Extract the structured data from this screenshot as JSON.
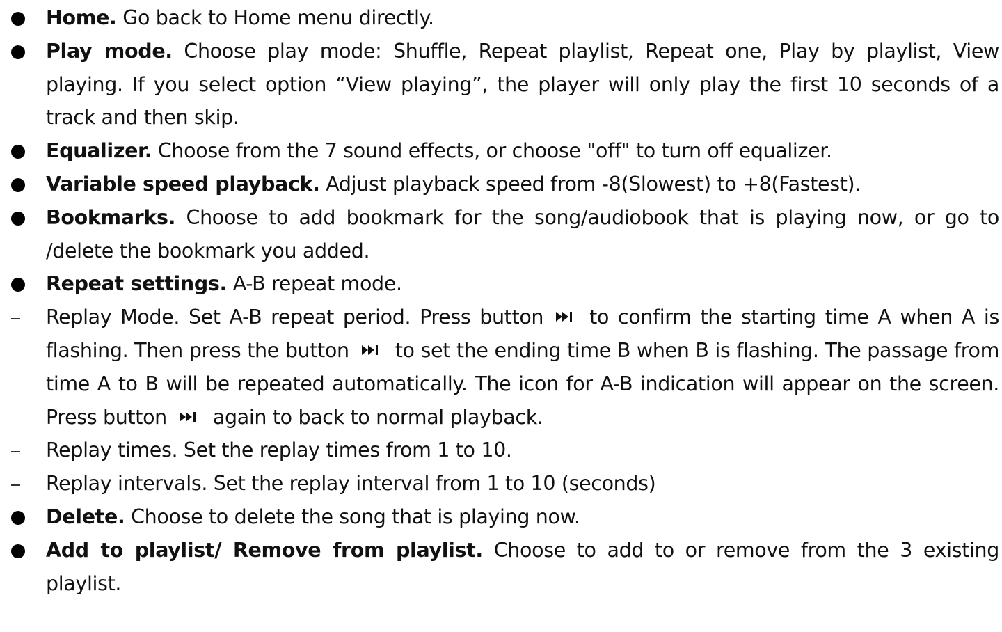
{
  "items": [
    {
      "type": "bullet",
      "title": "Home.",
      "text": " Go back to Home menu directly."
    },
    {
      "type": "bullet",
      "title": "Play mode.",
      "text": " Choose play mode: Shuffle, Repeat playlist, Repeat one, Play by playlist, View playing. If you select option “View playing”, the player will only play the first 10 seconds of a track and then skip."
    },
    {
      "type": "bullet",
      "title": "Equalizer.",
      "text": " Choose from the 7 sound effects, or choose \"off\" to turn off equalizer."
    },
    {
      "type": "bullet",
      "title": "Variable speed playback.",
      "text": " Adjust playback speed from -8(Slowest) to +8(Fastest)."
    },
    {
      "type": "bullet",
      "title": "Bookmarks.",
      "text": " Choose to add bookmark for the song/audiobook that is playing now, or go to /delete the bookmark you added."
    },
    {
      "type": "bullet",
      "title": "Repeat settings.",
      "text": " A-B repeat mode."
    },
    {
      "type": "dash",
      "parts": [
        "Replay Mode. Set A-B repeat period. Press button",
        "to confirm the starting time A when A is flashing. Then press the button",
        "to set the ending time B when B is flashing. The passage from time A to B will be repeated automatically. The icon for A-B indication will appear on the screen. Press button",
        "again to back to normal playback."
      ]
    },
    {
      "type": "dash",
      "text": "Replay times. Set the replay times from 1 to 10."
    },
    {
      "type": "dash",
      "text": "Replay intervals. Set the replay interval from 1 to 10 (seconds)"
    },
    {
      "type": "bullet",
      "title": "Delete.",
      "text": " Choose to delete the song that is playing now."
    },
    {
      "type": "bullet",
      "title": "Add to playlist/ Remove from playlist.",
      "text": " Choose to add to or remove from the 3 existing playlist."
    }
  ],
  "icons": {
    "next_button": "skip-forward-icon"
  }
}
